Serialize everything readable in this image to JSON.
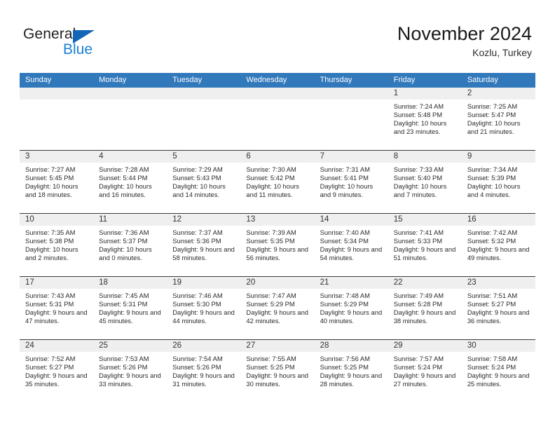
{
  "brand": {
    "name_part1": "General",
    "name_part2": "Blue",
    "accent_color": "#1266b5",
    "blue_text_color": "#1b7fd4"
  },
  "header": {
    "title": "November 2024",
    "subtitle": "Kozlu, Turkey"
  },
  "calendar": {
    "header_bg": "#3279bc",
    "weekdays": [
      "Sunday",
      "Monday",
      "Tuesday",
      "Wednesday",
      "Thursday",
      "Friday",
      "Saturday"
    ],
    "weeks": [
      [
        {
          "day": "",
          "sunrise": "",
          "sunset": "",
          "daylight": ""
        },
        {
          "day": "",
          "sunrise": "",
          "sunset": "",
          "daylight": ""
        },
        {
          "day": "",
          "sunrise": "",
          "sunset": "",
          "daylight": ""
        },
        {
          "day": "",
          "sunrise": "",
          "sunset": "",
          "daylight": ""
        },
        {
          "day": "",
          "sunrise": "",
          "sunset": "",
          "daylight": ""
        },
        {
          "day": "1",
          "sunrise": "Sunrise: 7:24 AM",
          "sunset": "Sunset: 5:48 PM",
          "daylight": "Daylight: 10 hours and 23 minutes."
        },
        {
          "day": "2",
          "sunrise": "Sunrise: 7:25 AM",
          "sunset": "Sunset: 5:47 PM",
          "daylight": "Daylight: 10 hours and 21 minutes."
        }
      ],
      [
        {
          "day": "3",
          "sunrise": "Sunrise: 7:27 AM",
          "sunset": "Sunset: 5:45 PM",
          "daylight": "Daylight: 10 hours and 18 minutes."
        },
        {
          "day": "4",
          "sunrise": "Sunrise: 7:28 AM",
          "sunset": "Sunset: 5:44 PM",
          "daylight": "Daylight: 10 hours and 16 minutes."
        },
        {
          "day": "5",
          "sunrise": "Sunrise: 7:29 AM",
          "sunset": "Sunset: 5:43 PM",
          "daylight": "Daylight: 10 hours and 14 minutes."
        },
        {
          "day": "6",
          "sunrise": "Sunrise: 7:30 AM",
          "sunset": "Sunset: 5:42 PM",
          "daylight": "Daylight: 10 hours and 11 minutes."
        },
        {
          "day": "7",
          "sunrise": "Sunrise: 7:31 AM",
          "sunset": "Sunset: 5:41 PM",
          "daylight": "Daylight: 10 hours and 9 minutes."
        },
        {
          "day": "8",
          "sunrise": "Sunrise: 7:33 AM",
          "sunset": "Sunset: 5:40 PM",
          "daylight": "Daylight: 10 hours and 7 minutes."
        },
        {
          "day": "9",
          "sunrise": "Sunrise: 7:34 AM",
          "sunset": "Sunset: 5:39 PM",
          "daylight": "Daylight: 10 hours and 4 minutes."
        }
      ],
      [
        {
          "day": "10",
          "sunrise": "Sunrise: 7:35 AM",
          "sunset": "Sunset: 5:38 PM",
          "daylight": "Daylight: 10 hours and 2 minutes."
        },
        {
          "day": "11",
          "sunrise": "Sunrise: 7:36 AM",
          "sunset": "Sunset: 5:37 PM",
          "daylight": "Daylight: 10 hours and 0 minutes."
        },
        {
          "day": "12",
          "sunrise": "Sunrise: 7:37 AM",
          "sunset": "Sunset: 5:36 PM",
          "daylight": "Daylight: 9 hours and 58 minutes."
        },
        {
          "day": "13",
          "sunrise": "Sunrise: 7:39 AM",
          "sunset": "Sunset: 5:35 PM",
          "daylight": "Daylight: 9 hours and 56 minutes."
        },
        {
          "day": "14",
          "sunrise": "Sunrise: 7:40 AM",
          "sunset": "Sunset: 5:34 PM",
          "daylight": "Daylight: 9 hours and 54 minutes."
        },
        {
          "day": "15",
          "sunrise": "Sunrise: 7:41 AM",
          "sunset": "Sunset: 5:33 PM",
          "daylight": "Daylight: 9 hours and 51 minutes."
        },
        {
          "day": "16",
          "sunrise": "Sunrise: 7:42 AM",
          "sunset": "Sunset: 5:32 PM",
          "daylight": "Daylight: 9 hours and 49 minutes."
        }
      ],
      [
        {
          "day": "17",
          "sunrise": "Sunrise: 7:43 AM",
          "sunset": "Sunset: 5:31 PM",
          "daylight": "Daylight: 9 hours and 47 minutes."
        },
        {
          "day": "18",
          "sunrise": "Sunrise: 7:45 AM",
          "sunset": "Sunset: 5:31 PM",
          "daylight": "Daylight: 9 hours and 45 minutes."
        },
        {
          "day": "19",
          "sunrise": "Sunrise: 7:46 AM",
          "sunset": "Sunset: 5:30 PM",
          "daylight": "Daylight: 9 hours and 44 minutes."
        },
        {
          "day": "20",
          "sunrise": "Sunrise: 7:47 AM",
          "sunset": "Sunset: 5:29 PM",
          "daylight": "Daylight: 9 hours and 42 minutes."
        },
        {
          "day": "21",
          "sunrise": "Sunrise: 7:48 AM",
          "sunset": "Sunset: 5:29 PM",
          "daylight": "Daylight: 9 hours and 40 minutes."
        },
        {
          "day": "22",
          "sunrise": "Sunrise: 7:49 AM",
          "sunset": "Sunset: 5:28 PM",
          "daylight": "Daylight: 9 hours and 38 minutes."
        },
        {
          "day": "23",
          "sunrise": "Sunrise: 7:51 AM",
          "sunset": "Sunset: 5:27 PM",
          "daylight": "Daylight: 9 hours and 36 minutes."
        }
      ],
      [
        {
          "day": "24",
          "sunrise": "Sunrise: 7:52 AM",
          "sunset": "Sunset: 5:27 PM",
          "daylight": "Daylight: 9 hours and 35 minutes."
        },
        {
          "day": "25",
          "sunrise": "Sunrise: 7:53 AM",
          "sunset": "Sunset: 5:26 PM",
          "daylight": "Daylight: 9 hours and 33 minutes."
        },
        {
          "day": "26",
          "sunrise": "Sunrise: 7:54 AM",
          "sunset": "Sunset: 5:26 PM",
          "daylight": "Daylight: 9 hours and 31 minutes."
        },
        {
          "day": "27",
          "sunrise": "Sunrise: 7:55 AM",
          "sunset": "Sunset: 5:25 PM",
          "daylight": "Daylight: 9 hours and 30 minutes."
        },
        {
          "day": "28",
          "sunrise": "Sunrise: 7:56 AM",
          "sunset": "Sunset: 5:25 PM",
          "daylight": "Daylight: 9 hours and 28 minutes."
        },
        {
          "day": "29",
          "sunrise": "Sunrise: 7:57 AM",
          "sunset": "Sunset: 5:24 PM",
          "daylight": "Daylight: 9 hours and 27 minutes."
        },
        {
          "day": "30",
          "sunrise": "Sunrise: 7:58 AM",
          "sunset": "Sunset: 5:24 PM",
          "daylight": "Daylight: 9 hours and 25 minutes."
        }
      ]
    ]
  }
}
